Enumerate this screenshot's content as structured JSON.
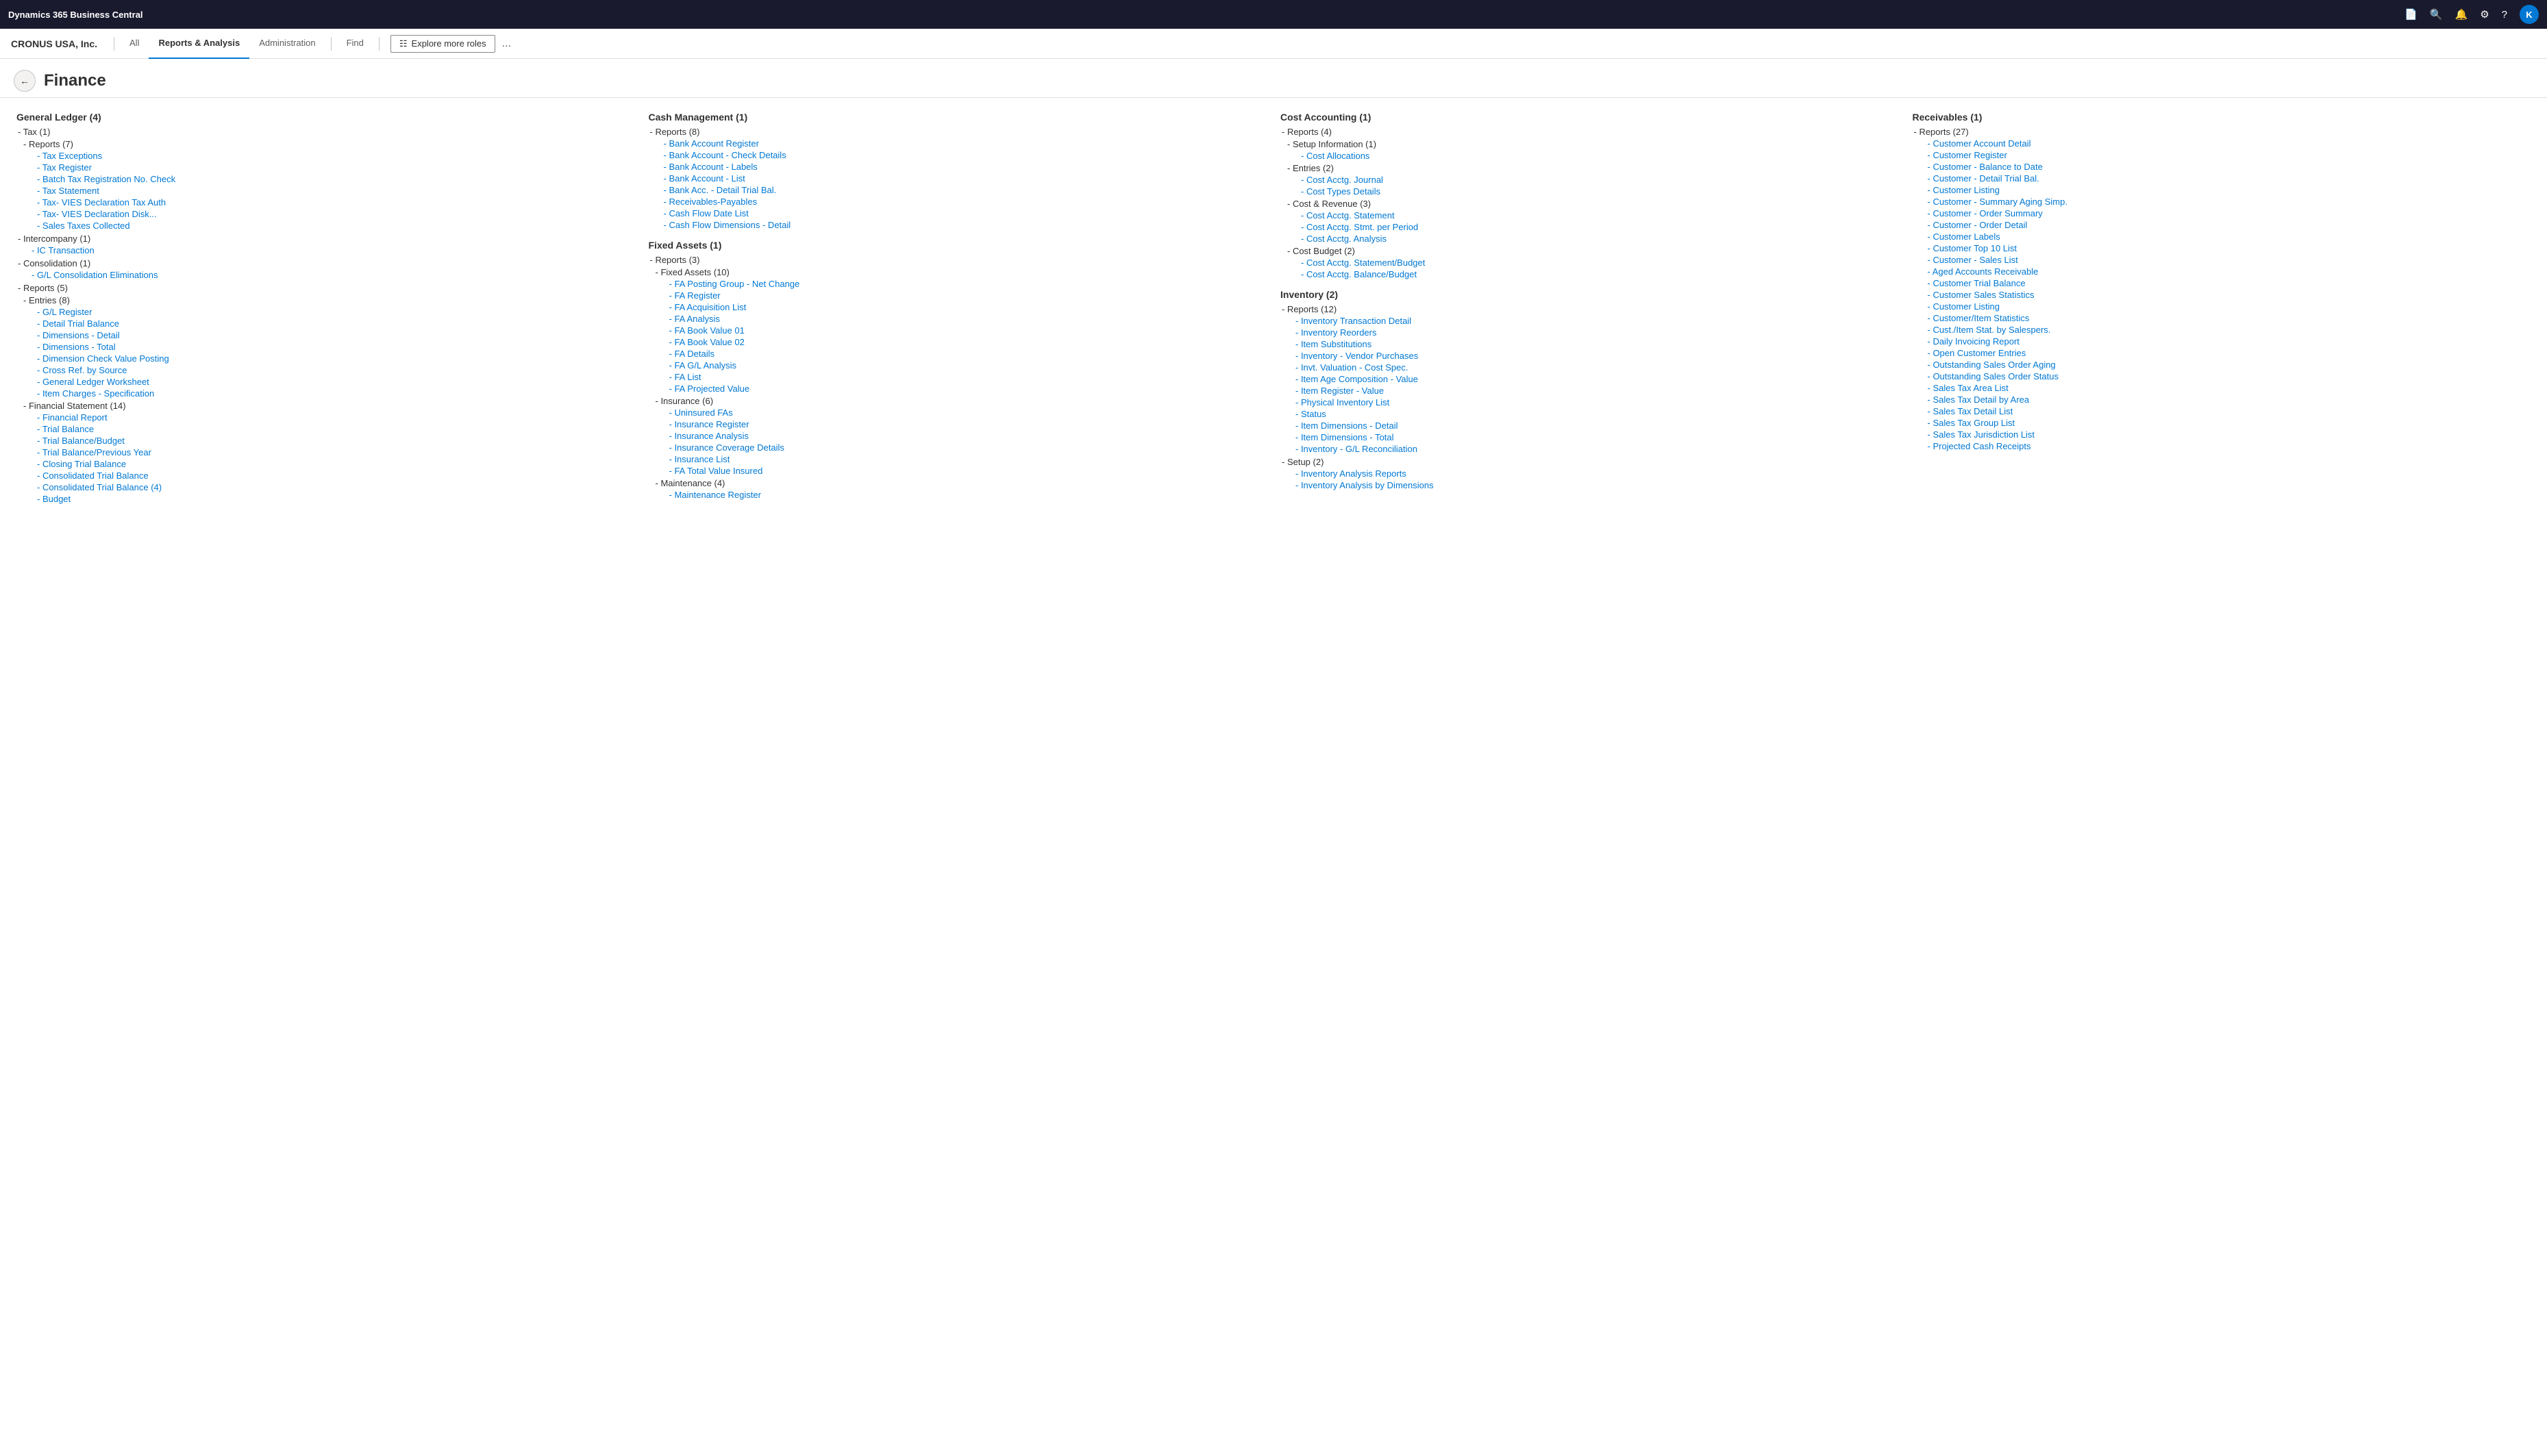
{
  "topBar": {
    "title": "Dynamics 365 Business Central",
    "avatarLabel": "K"
  },
  "secNav": {
    "companyName": "CRONUS USA, Inc.",
    "tabs": [
      {
        "label": "All",
        "active": false
      },
      {
        "label": "Reports & Analysis",
        "active": true
      },
      {
        "label": "Administration",
        "active": false
      },
      {
        "label": "Find",
        "active": false
      }
    ],
    "exploreBtn": "Explore more roles",
    "moreBtn": "..."
  },
  "page": {
    "backBtn": "←",
    "title": "Finance"
  },
  "columns": {
    "col1": {
      "title": "General Ledger (4)",
      "sections": [
        {
          "label": "- Tax (1)",
          "children": [
            {
              "label": "- Reports (7)",
              "children": [
                {
                  "label": "- Tax Exceptions"
                },
                {
                  "label": "- Tax Register"
                },
                {
                  "label": "- Batch Tax Registration No. Check"
                },
                {
                  "label": "- Tax Statement"
                },
                {
                  "label": "- Tax- VIES Declaration Tax Auth"
                },
                {
                  "label": "- Tax- VIES Declaration Disk..."
                },
                {
                  "label": "- Sales Taxes Collected"
                }
              ]
            }
          ]
        },
        {
          "label": "- Intercompany (1)",
          "children": [
            {
              "label": "- IC Transaction"
            }
          ]
        },
        {
          "label": "- Consolidation (1)",
          "children": [
            {
              "label": "- G/L Consolidation Eliminations"
            }
          ]
        },
        {
          "label": "- Reports (5)",
          "children": [
            {
              "label": "- Entries (8)",
              "children": [
                {
                  "label": "- G/L Register"
                },
                {
                  "label": "- Detail Trial Balance"
                },
                {
                  "label": "- Dimensions - Detail"
                },
                {
                  "label": "- Dimensions - Total"
                },
                {
                  "label": "- Dimension Check Value Posting"
                },
                {
                  "label": "- Cross Ref. by Source"
                },
                {
                  "label": "- General Ledger Worksheet"
                },
                {
                  "label": "- Item Charges - Specification"
                }
              ]
            },
            {
              "label": "- Financial Statement (14)",
              "children": [
                {
                  "label": "- Financial Report"
                },
                {
                  "label": "- Trial Balance"
                },
                {
                  "label": "- Trial Balance/Budget"
                },
                {
                  "label": "- Trial Balance/Previous Year"
                },
                {
                  "label": "- Closing Trial Balance"
                },
                {
                  "label": "- Consolidated Trial Balance"
                },
                {
                  "label": "- Consolidated Trial Balance (4)"
                },
                {
                  "label": "- Budget"
                }
              ]
            }
          ]
        }
      ]
    },
    "col2": {
      "title": "Cash Management (1)",
      "sections": [
        {
          "label": "- Reports (8)",
          "children": [
            {
              "label": "- Bank Account Register"
            },
            {
              "label": "- Bank Account - Check Details"
            },
            {
              "label": "- Bank Account - Labels"
            },
            {
              "label": "- Bank Account - List"
            },
            {
              "label": "- Bank Acc. - Detail Trial Bal."
            },
            {
              "label": "- Receivables-Payables"
            },
            {
              "label": "- Cash Flow Date List"
            },
            {
              "label": "- Cash Flow Dimensions - Detail"
            }
          ]
        },
        {
          "label": "Fixed Assets (1)",
          "isHeader": true,
          "children": [
            {
              "label": "- Reports (3)",
              "children": [
                {
                  "label": "- Fixed Assets (10)",
                  "children": [
                    {
                      "label": "- FA Posting Group - Net Change"
                    },
                    {
                      "label": "- FA Register"
                    },
                    {
                      "label": "- FA Acquisition List"
                    },
                    {
                      "label": "- FA Analysis"
                    },
                    {
                      "label": "- FA Book Value 01"
                    },
                    {
                      "label": "- FA Book Value 02"
                    },
                    {
                      "label": "- FA Details"
                    },
                    {
                      "label": "- FA G/L Analysis"
                    },
                    {
                      "label": "- FA List"
                    },
                    {
                      "label": "- FA Projected Value"
                    }
                  ]
                },
                {
                  "label": "- Insurance (6)",
                  "children": [
                    {
                      "label": "- Uninsured FAs"
                    },
                    {
                      "label": "- Insurance Register"
                    },
                    {
                      "label": "- Insurance Analysis"
                    },
                    {
                      "label": "- Insurance Coverage Details"
                    },
                    {
                      "label": "- Insurance List"
                    },
                    {
                      "label": "- FA Total Value Insured"
                    }
                  ]
                },
                {
                  "label": "- Maintenance (4)",
                  "children": [
                    {
                      "label": "- Maintenance Register"
                    }
                  ]
                }
              ]
            }
          ]
        }
      ]
    },
    "col3": {
      "title": "Cost Accounting (1)",
      "sections": [
        {
          "label": "- Reports (4)",
          "children": [
            {
              "label": "- Setup Information (1)",
              "children": [
                {
                  "label": "- Cost Allocations"
                }
              ]
            },
            {
              "label": "- Entries (2)",
              "children": [
                {
                  "label": "- Cost Acctg. Journal"
                },
                {
                  "label": "- Cost Types Details"
                }
              ]
            },
            {
              "label": "- Cost & Revenue (3)",
              "children": [
                {
                  "label": "- Cost Acctg. Statement"
                },
                {
                  "label": "- Cost Acctg. Stmt. per Period"
                },
                {
                  "label": "- Cost Acctg. Analysis"
                }
              ]
            },
            {
              "label": "- Cost Budget (2)",
              "children": [
                {
                  "label": "- Cost Acctg. Statement/Budget"
                },
                {
                  "label": "- Cost Acctg. Balance/Budget"
                }
              ]
            }
          ]
        },
        {
          "label": "Inventory (2)",
          "isHeader": true,
          "children": [
            {
              "label": "- Reports (12)",
              "children": [
                {
                  "label": "- Inventory Transaction Detail"
                },
                {
                  "label": "- Inventory Reorders"
                },
                {
                  "label": "- Item Substitutions"
                },
                {
                  "label": "- Inventory - Vendor Purchases"
                },
                {
                  "label": "- Invt. Valuation - Cost Spec."
                },
                {
                  "label": "- Item Age Composition - Value"
                },
                {
                  "label": "- Item Register - Value"
                },
                {
                  "label": "- Physical Inventory List"
                },
                {
                  "label": "- Status"
                },
                {
                  "label": "- Item Dimensions - Detail"
                },
                {
                  "label": "- Item Dimensions - Total"
                },
                {
                  "label": "- Inventory - G/L Reconciliation"
                }
              ]
            },
            {
              "label": "- Setup (2)",
              "children": [
                {
                  "label": "- Inventory Analysis Reports"
                },
                {
                  "label": "- Inventory Analysis by Dimensions"
                }
              ]
            }
          ]
        }
      ]
    },
    "col4": {
      "title": "Receivables (1)",
      "sections": [
        {
          "label": "- Reports (27)",
          "children": [
            {
              "label": "- Customer Account Detail"
            },
            {
              "label": "- Customer Register"
            },
            {
              "label": "- Customer - Balance to Date"
            },
            {
              "label": "- Customer - Detail Trial Bal."
            },
            {
              "label": "- Customer Listing"
            },
            {
              "label": "- Customer - Summary Aging Simp."
            },
            {
              "label": "- Customer - Order Summary"
            },
            {
              "label": "- Customer - Order Detail"
            },
            {
              "label": "- Customer Labels"
            },
            {
              "label": "- Customer Top 10 List"
            },
            {
              "label": "- Customer - Sales List"
            },
            {
              "label": "- Aged Accounts Receivable"
            },
            {
              "label": "- Customer Trial Balance"
            },
            {
              "label": "- Customer Sales Statistics"
            },
            {
              "label": "- Customer Listing"
            },
            {
              "label": "- Customer/Item Statistics"
            },
            {
              "label": "- Cust./Item Stat. by Salespers."
            },
            {
              "label": "- Daily Invoicing Report"
            },
            {
              "label": "- Open Customer Entries"
            },
            {
              "label": "- Outstanding Sales Order Aging"
            },
            {
              "label": "- Outstanding Sales Order Status"
            },
            {
              "label": "- Sales Tax Area List"
            },
            {
              "label": "- Sales Tax Detail by Area"
            },
            {
              "label": "- Sales Tax Detail List"
            },
            {
              "label": "- Sales Tax Group List"
            },
            {
              "label": "- Sales Tax Jurisdiction List"
            },
            {
              "label": "- Projected Cash Receipts"
            }
          ]
        }
      ]
    }
  }
}
